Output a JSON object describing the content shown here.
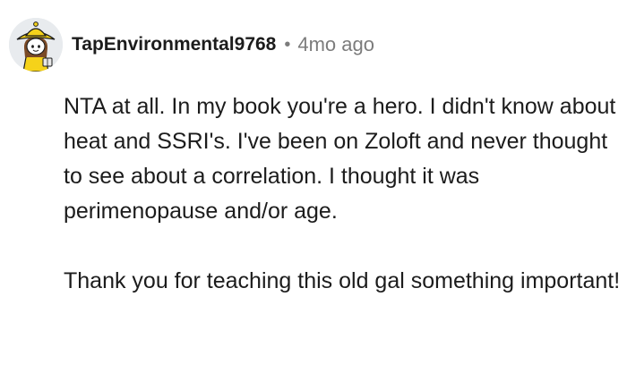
{
  "comment": {
    "author": {
      "username": "TapEnvironmental9768",
      "avatar_icon": "snoo-yellow-raincoat-avatar-icon"
    },
    "separator": "•",
    "timestamp": "4mo ago",
    "body": {
      "paragraphs": [
        "NTA at all. In my book you're a hero. I didn't know about heat and SSRI's. I've been on Zoloft and never thought to see about a correlation. I thought it was perimenopause and/or age.",
        "Thank you for teaching this old gal something important!"
      ]
    }
  },
  "colors": {
    "text": "#1c1c1c",
    "meta": "#7c7c7c",
    "background": "#ffffff",
    "avatar_raincoat": "#f5d21a",
    "avatar_background": "#e8ebee"
  }
}
